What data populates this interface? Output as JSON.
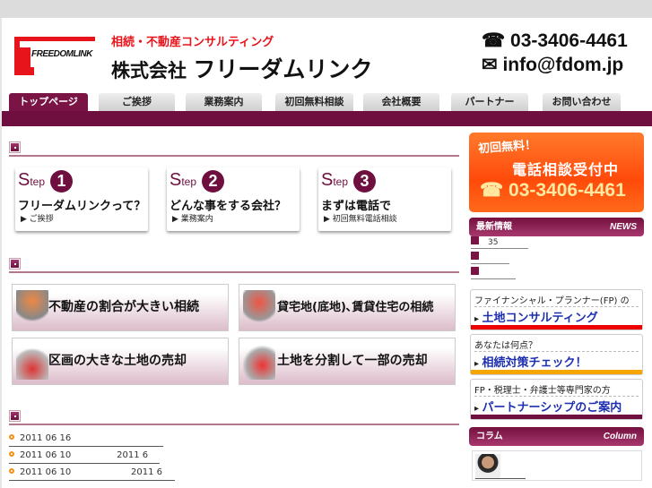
{
  "header": {
    "logo_text": "FREEDOMLINK",
    "tagline": "相続・不動産コンサルティング",
    "company_prefix": "株式会社",
    "company_name": "フリーダムリンク",
    "phone": "03-3406-4461",
    "email": "info@fdom.jp",
    "phone_icon": "☎",
    "mail_icon": "✉"
  },
  "nav": {
    "tabs": [
      "トップページ",
      "ご挨拶",
      "業務案内",
      "初回無料相談",
      "会社概要",
      "パートナー",
      "お問い合わせ"
    ]
  },
  "steps": [
    {
      "s": "S",
      "tep": "tep",
      "num": "1",
      "title": "フリーダムリンクって？",
      "link": "▶ ご挨拶"
    },
    {
      "s": "S",
      "tep": "tep",
      "num": "2",
      "title": "どんな事をする会社？",
      "link": "▶ 業務案内"
    },
    {
      "s": "S",
      "tep": "tep",
      "num": "3",
      "title": "まずは電話で",
      "link": "▶ 初回無料電話相談"
    }
  ],
  "banners": [
    "不動産の割合が大きい相続",
    "貸宅地(底地)､賃貸住宅の相続",
    "区画の大きな土地の売却",
    "土地を分割して一部の売却"
  ],
  "news_list": [
    "2011 06 16",
    "2011 06 10                2011 6",
    "2011 06 10                     2011 6"
  ],
  "sidebar": {
    "promo": {
      "line1": "初回無料！",
      "line2": "電話相談受付中",
      "phone": "03-3406-4461"
    },
    "news_header": {
      "jp": "最新情報",
      "en": "NEWS"
    },
    "news_items": [
      "35",
      "",
      ""
    ],
    "cards": [
      {
        "top": "ファイナンシャル・プランナー(FP) の",
        "link": "土地コンサルティング",
        "color": "#ee0000"
      },
      {
        "top": "あなたは何点？",
        "link": "相続対策チェック！",
        "color": "#f7a600"
      },
      {
        "top": "FP・税理士・弁護士等専門家の方",
        "link": "パートナーシップのご案内",
        "color": "#6e0f3f"
      }
    ],
    "column_header": {
      "jp": "コラム",
      "en": "Column"
    }
  },
  "colors": {
    "accent": "#6e0f3f",
    "orange": "#ff5a10"
  }
}
